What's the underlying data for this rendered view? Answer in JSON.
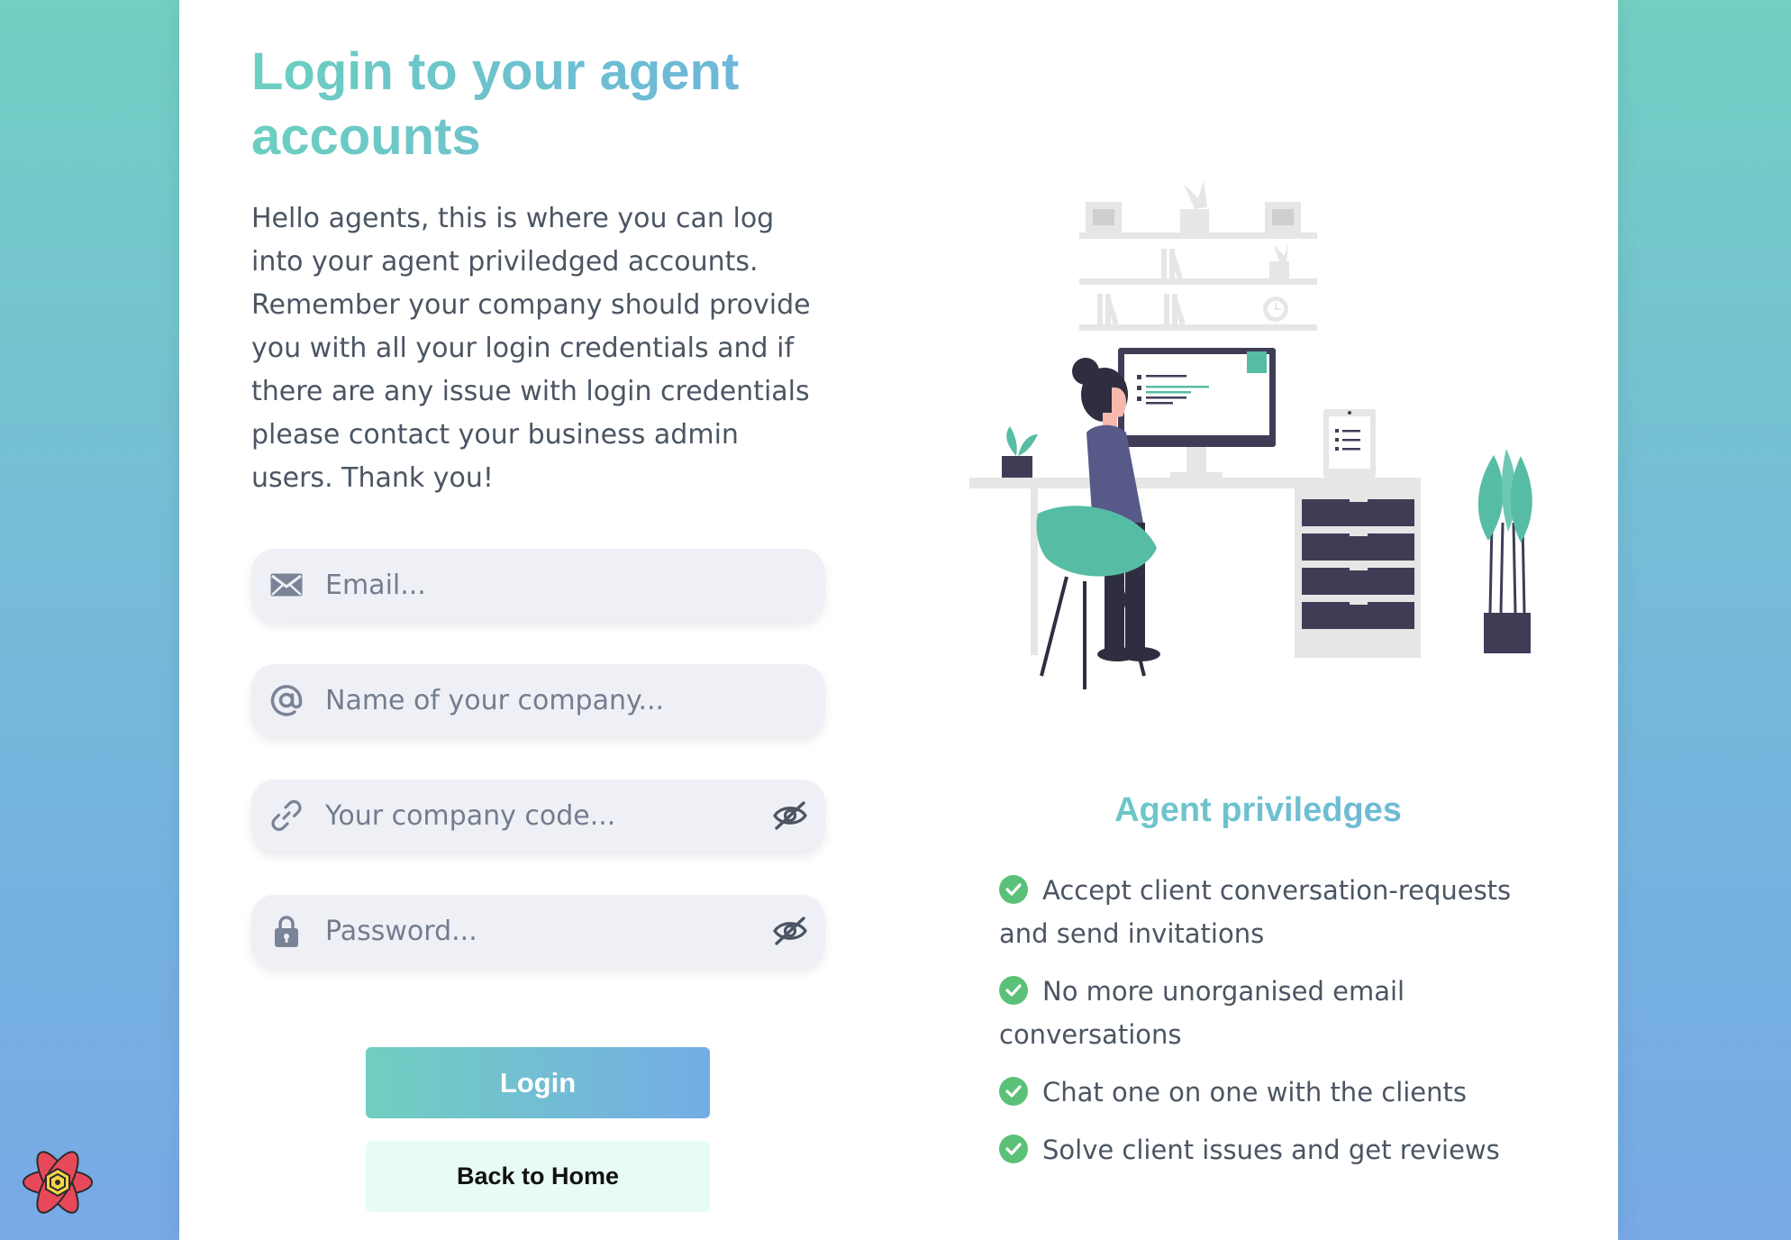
{
  "login": {
    "title": "Login to your agent accounts",
    "intro": "Hello agents, this is where you can log into your agent priviledged accounts. Remember your company should provide you with all your login credentials and if there are any issue with login credentials please contact your business admin users. Thank you!",
    "fields": {
      "email": {
        "placeholder": "Email...",
        "icon": "mail-icon"
      },
      "company_name": {
        "placeholder": "Name of your company...",
        "icon": "at-sign-icon"
      },
      "company_code": {
        "placeholder": "Your company code...",
        "icon": "link-icon",
        "toggle_icon": "eye-off-icon"
      },
      "password": {
        "placeholder": "Password...",
        "icon": "lock-icon",
        "toggle_icon": "eye-off-icon"
      }
    },
    "login_button": "Login",
    "home_button": "Back to Home"
  },
  "privileges": {
    "title": "Agent priviledges",
    "items": [
      "Accept client conversation-requests and send invitations",
      "No more unorganised email conversations",
      "Chat one on one with the clients",
      "Solve client issues and get reviews"
    ]
  },
  "colors": {
    "accent_start": "#6ccfc0",
    "accent_end": "#6fb2de",
    "check": "#5cc178",
    "field_bg": "#eef0f5",
    "home_button_bg": "#e8fcf6"
  }
}
